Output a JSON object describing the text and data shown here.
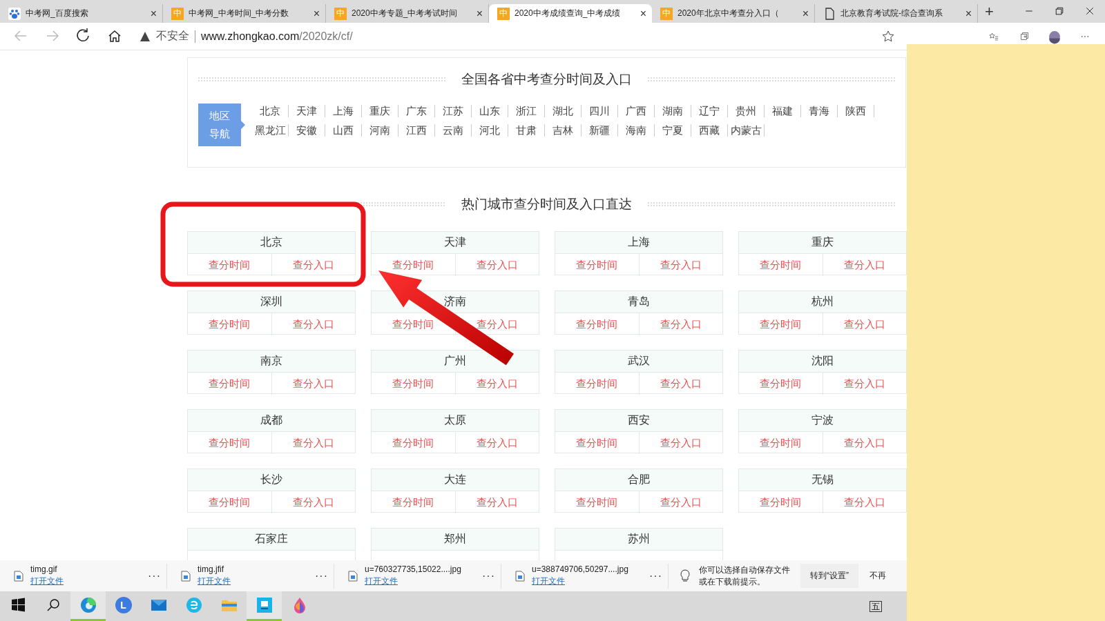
{
  "tabs": [
    {
      "kind": "paw",
      "title": "中考网_百度搜索",
      "close": "×",
      "selected": false
    },
    {
      "kind": "badge",
      "badge": "中",
      "title": "中考网_中考时间_中考分数",
      "close": "×",
      "selected": false
    },
    {
      "kind": "badge",
      "badge": "中",
      "title": "2020中考专题_中考考试时间",
      "close": "×",
      "selected": false
    },
    {
      "kind": "badge",
      "badge": "中",
      "title": "2020中考成绩查询_中考成绩",
      "close": "×",
      "selected": true
    },
    {
      "kind": "badge",
      "badge": "中",
      "title": "2020年北京中考查分入口（",
      "close": "×",
      "selected": false
    },
    {
      "kind": "page",
      "title": "北京教育考试院-综合查询系",
      "close": "×",
      "selected": false
    }
  ],
  "new_tab": "+",
  "address_bar": {
    "security": "不安全",
    "host": "www.zhongkao.com",
    "path": "/2020zk/cf/"
  },
  "province_nav": {
    "title": "全国各省中考查分时间及入口",
    "label": [
      "地区",
      "导航"
    ],
    "rows": [
      [
        "北京",
        "天津",
        "上海",
        "重庆",
        "广东",
        "江苏",
        "山东",
        "浙江",
        "湖北",
        "四川",
        "广西",
        "湖南",
        "辽宁",
        "贵州",
        "福建",
        "青海",
        "陕西"
      ],
      [
        "黑龙江",
        "安徽",
        "山西",
        "河南",
        "江西",
        "云南",
        "河北",
        "甘肃",
        "吉林",
        "新疆",
        "海南",
        "宁夏",
        "西藏",
        "内蒙古"
      ]
    ]
  },
  "hot_cities": {
    "title": "热门城市查分时间及入口直达",
    "cities": [
      {
        "name": "北京",
        "links": [
          "查分时间",
          "查分入口"
        ]
      },
      {
        "name": "天津",
        "links": [
          "查分时间",
          "查分入口"
        ]
      },
      {
        "name": "上海",
        "links": [
          "查分时间",
          "查分入口"
        ]
      },
      {
        "name": "重庆",
        "links": [
          "查分时间",
          "查分入口"
        ]
      },
      {
        "name": "深圳",
        "links": [
          "查分时间",
          "查分入口"
        ]
      },
      {
        "name": "济南",
        "links": [
          "查分时间",
          "查分入口"
        ]
      },
      {
        "name": "青岛",
        "links": [
          "查分时间",
          "查分入口"
        ]
      },
      {
        "name": "杭州",
        "links": [
          "查分时间",
          "查分入口"
        ]
      },
      {
        "name": "南京",
        "links": [
          "查分时间",
          "查分入口"
        ]
      },
      {
        "name": "广州",
        "links": [
          "查分时间",
          "查分入口"
        ]
      },
      {
        "name": "武汉",
        "links": [
          "查分时间",
          "查分入口"
        ]
      },
      {
        "name": "沈阳",
        "links": [
          "查分时间",
          "查分入口"
        ]
      },
      {
        "name": "成都",
        "links": [
          "查分时间",
          "查分入口"
        ]
      },
      {
        "name": "太原",
        "links": [
          "查分时间",
          "查分入口"
        ]
      },
      {
        "name": "西安",
        "links": [
          "查分时间",
          "查分入口"
        ]
      },
      {
        "name": "宁波",
        "links": [
          "查分时间",
          "查分入口"
        ]
      },
      {
        "name": "长沙",
        "links": [
          "查分时间",
          "查分入口"
        ]
      },
      {
        "name": "大连",
        "links": [
          "查分时间",
          "查分入口"
        ]
      },
      {
        "name": "合肥",
        "links": [
          "查分时间",
          "查分入口"
        ]
      },
      {
        "name": "无锡",
        "links": [
          "查分时间",
          "查分入口"
        ]
      },
      {
        "name": "石家庄"
      },
      {
        "name": "郑州"
      },
      {
        "name": "苏州"
      }
    ]
  },
  "downloads": [
    {
      "file": "timg.gif",
      "action": "打开文件",
      "more": "···"
    },
    {
      "file": "timg.jfif",
      "action": "打开文件",
      "more": "···"
    },
    {
      "file": "u=760327735,15022....jpg",
      "action": "打开文件",
      "more": "···"
    },
    {
      "file": "u=388749706,50297....jpg",
      "action": "打开文件",
      "more": "···"
    }
  ],
  "download_tip": {
    "text": "你可以选择自动保存文件或在下载前提示。",
    "buttons": [
      "转到“设置”",
      "不再"
    ]
  },
  "taskbar": {
    "apps": [
      {
        "kind": "edge",
        "selected": true
      },
      {
        "kind": "letter-app",
        "badge": "L",
        "selected": false
      },
      {
        "kind": "mail",
        "selected": false
      },
      {
        "kind": "swirl-app",
        "selected": false
      },
      {
        "kind": "folder",
        "selected": false
      },
      {
        "kind": "square-app",
        "selected": true
      },
      {
        "kind": "drop",
        "selected": false
      }
    ],
    "ime": "五"
  }
}
